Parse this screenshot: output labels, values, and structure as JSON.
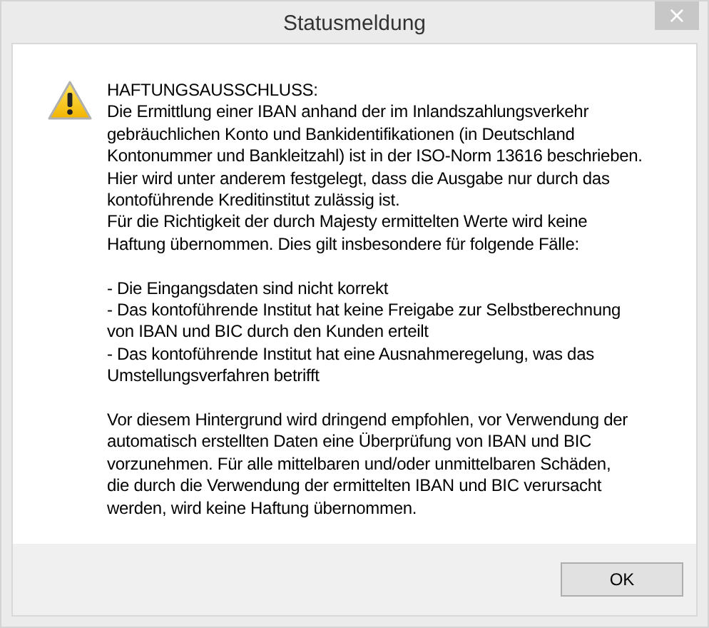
{
  "window": {
    "title": "Statusmeldung",
    "close": "×"
  },
  "message": {
    "paragraphs": [
      {
        "lines": [
          "HAFTUNGSAUSSCHLUSS:",
          "Die Ermittlung einer IBAN anhand der im Inlandszahlungsverkehr",
          "gebräuchlichen Konto und Bankidentifikationen (in Deutschland",
          "Kontonummer und Bankleitzahl) ist in der ISO-Norm 13616 beschrieben.",
          "Hier wird unter anderem festgelegt, dass die Ausgabe nur durch das",
          "kontoführende Kreditinstitut zulässig ist.",
          "Für die Richtigkeit der durch Majesty ermittelten Werte wird keine",
          "Haftung übernommen. Dies gilt insbesondere für folgende Fälle:"
        ]
      },
      {
        "lines": [
          "- Die Eingangsdaten sind nicht korrekt",
          "- Das kontoführende Institut hat keine Freigabe zur Selbstberechnung",
          "von IBAN und BIC durch den Kunden erteilt",
          "- Das kontoführende Institut hat eine Ausnahmeregelung, was das",
          "Umstellungsverfahren betrifft"
        ]
      },
      {
        "lines": [
          "Vor diesem Hintergrund wird dringend empfohlen, vor Verwendung der",
          "automatisch erstellten Daten eine Überprüfung von IBAN und BIC",
          "vorzunehmen. Für alle mittelbaren und/oder unmittelbaren Schäden,",
          "die durch die Verwendung der ermittelten IBAN und BIC verursacht",
          "werden, wird keine Haftung übernommen."
        ]
      }
    ]
  },
  "buttons": [
    "OK"
  ]
}
